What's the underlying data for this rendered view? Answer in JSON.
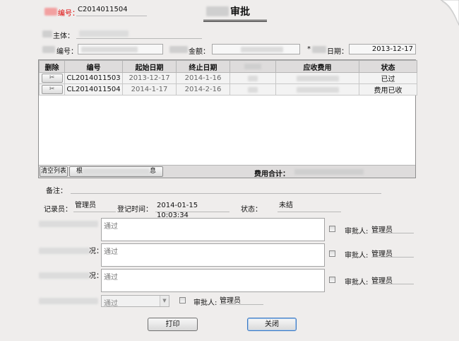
{
  "header": {
    "number_label": "编号：",
    "number_value": "C2014011504",
    "title": "审批"
  },
  "form": {
    "subject_label": "主体：",
    "contract_label": "编号：",
    "amount_label": "金额：",
    "required_mark": "*",
    "date_label": "日期：",
    "date_value": "2013-12-17"
  },
  "table": {
    "columns": [
      "删除",
      "编号",
      "起始日期",
      "终止日期",
      "",
      "应收费用",
      "状态"
    ],
    "rows": [
      {
        "delete_label": "删除",
        "number": "CL2014011503",
        "start": "2013-12-17",
        "end": "2014-1-16",
        "status": "已过"
      },
      {
        "delete_label": "删除",
        "number": "CL2014011504",
        "start": "2014-1-17",
        "end": "2014-2-16",
        "status": "费用已收"
      }
    ],
    "clear_button": "清空列表",
    "fetch_button_prefix": "根",
    "fetch_button_suffix": "息",
    "total_label": "费用合计："
  },
  "remarks": {
    "label": "备注："
  },
  "record": {
    "recorder_label": "记录员：",
    "recorder_value": "管理员",
    "time_label": "登记时间：",
    "time_value": "2014-01-15 10:03:34",
    "status_label": "状态：",
    "status_value": "未结"
  },
  "approvals": [
    {
      "text": "通过",
      "approver_label": "审批人:",
      "approver_value": "管理员"
    },
    {
      "text": "通过",
      "approver_label": "审批人:",
      "approver_value": "管理员",
      "label_suffix": "况："
    },
    {
      "text": "通过",
      "approver_label": "审批人:",
      "approver_value": "管理员",
      "label_suffix": "况："
    }
  ],
  "final_approval": {
    "select_value": "通过",
    "approver_label": "审批人:",
    "approver_value": "管理员"
  },
  "buttons": {
    "print": "打印",
    "close": "关闭"
  }
}
